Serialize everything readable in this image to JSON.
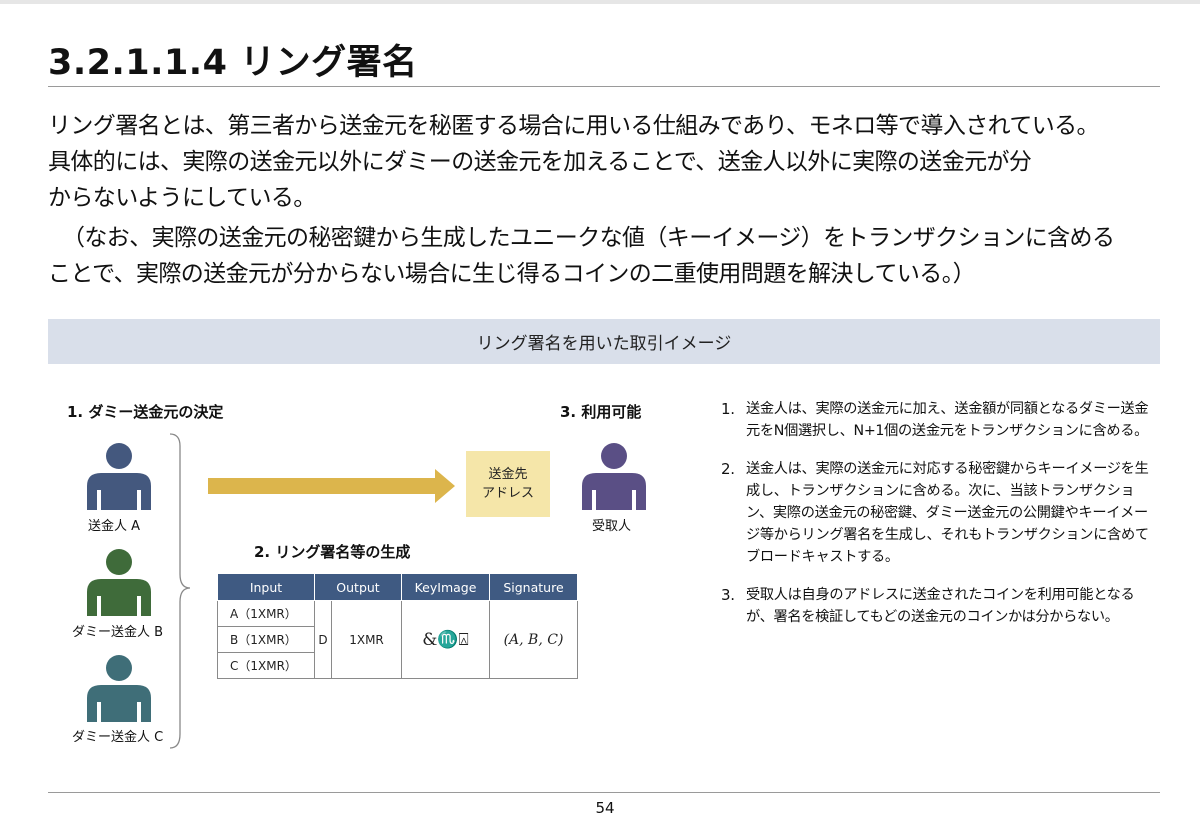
{
  "heading": {
    "title": "3.2.1.1.4 リング署名"
  },
  "intro": {
    "line1": "リング署名とは、第三者から送金元を秘匿する場合に用いる仕組みであり、モネロ等で導入されている。",
    "line2": "具体的には、実際の送金元以外にダミーの送金元を加えることで、送金人以外に実際の送金元が分",
    "line3": "からないようにしている。",
    "line4": "（なお、実際の送金元の秘密鍵から生成したユニークな値（キーイメージ）をトランザクションに含める",
    "line5": "ことで、実際の送金元が分からない場合に生じ得るコインの二重使用問題を解決している。）"
  },
  "diagram": {
    "banner_title": "リング署名を用いた取引イメージ",
    "step1_label": "1. ダミー送金元の決定",
    "step2_label": "2. リング署名等の生成",
    "step3_label": "3. 利用可能",
    "sender_a": "送金人 A",
    "sender_b": "ダミー送金人 B",
    "sender_c": "ダミー送金人 C",
    "receiver": "受取人",
    "address_line1": "送金先",
    "address_line2": "アドレス",
    "colors": {
      "sender_a": "#44587e",
      "sender_b": "#3f6b3a",
      "sender_c": "#3f6e78",
      "receiver": "#5a4f85",
      "arrow": "#dcb54c",
      "address_box": "#f5e6a9",
      "table_header": "#3f5a82",
      "banner": "#d9dfea"
    },
    "table": {
      "headers": [
        "Input",
        "Output",
        "KeyImage",
        "Signature"
      ],
      "inputs": [
        "A（1XMR）",
        "B（1XMR）",
        "C（1XMR）"
      ],
      "output_tag": "D",
      "output_value": "1XMR",
      "keyimage": "&♏⍓",
      "signature": "(A, B, C)"
    }
  },
  "steps": [
    {
      "num": "1.",
      "text": "送金人は、実際の送金元に加え、送金額が同額となるダミー送金元をN個選択し、N+1個の送金元をトランザクションに含める。"
    },
    {
      "num": "2.",
      "text": "送金人は、実際の送金元に対応する秘密鍵からキーイメージを生成し、トランザクションに含める。次に、当該トランザクション、実際の送金元の秘密鍵、ダミー送金元の公開鍵やキーイメージ等からリング署名を生成し、それもトランザクションに含めてブロードキャストする。"
    },
    {
      "num": "3.",
      "text": "受取人は自身のアドレスに送金されたコインを利用可能となるが、署名を検証してもどの送金元のコインかは分からない。"
    }
  ],
  "footer": {
    "page_number": "54"
  }
}
